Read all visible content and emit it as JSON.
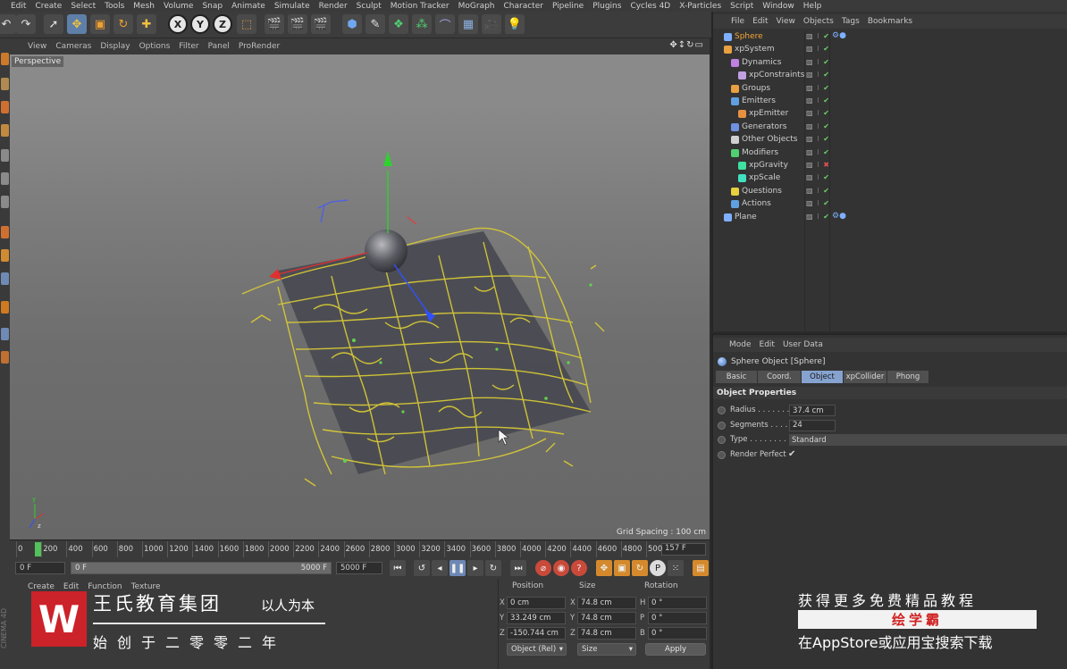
{
  "menubar": [
    "Edit",
    "Create",
    "Select",
    "Tools",
    "Mesh",
    "Volume",
    "Snap",
    "Animate",
    "Simulate",
    "Render",
    "Sculpt",
    "Motion Tracker",
    "MoGraph",
    "Character",
    "Pipeline",
    "Plugins",
    "Cycles 4D",
    "X-Particles",
    "Script",
    "Window",
    "Help"
  ],
  "viewport": {
    "menu": [
      "View",
      "Cameras",
      "Display",
      "Options",
      "Filter",
      "Panel",
      "ProRender"
    ],
    "label": "Perspective",
    "grid_spacing": "Grid Spacing : 100 cm"
  },
  "timeline": {
    "ticks": [
      "0",
      "200",
      "400",
      "600",
      "800",
      "1000",
      "1200",
      "1400",
      "1600",
      "1800",
      "2000",
      "2200",
      "2400",
      "2600",
      "2800",
      "3000",
      "3200",
      "3400",
      "3600",
      "3800",
      "4000",
      "4200",
      "4400",
      "4600",
      "4800",
      "500"
    ],
    "current_frame": "157 F"
  },
  "transport": {
    "start": "0 F",
    "range_start": "0 F",
    "range_end": "5000 F",
    "end": "5000 F"
  },
  "bottom_menu": [
    "Create",
    "Edit",
    "Function",
    "Texture"
  ],
  "cinema_tag": "CINEMA 4D",
  "coord": {
    "headers": {
      "position": "Position",
      "size": "Size",
      "rotation": "Rotation"
    },
    "rows": [
      {
        "axis": "X",
        "pos": "0 cm",
        "size_axis": "X",
        "size": "74.8 cm",
        "rot_axis": "H",
        "rot": "0 °"
      },
      {
        "axis": "Y",
        "pos": "33.249 cm",
        "size_axis": "Y",
        "size": "74.8 cm",
        "rot_axis": "P",
        "rot": "0 °"
      },
      {
        "axis": "Z",
        "pos": "-150.744 cm",
        "size_axis": "Z",
        "size": "74.8 cm",
        "rot_axis": "B",
        "rot": "0 °"
      }
    ],
    "mode": "Object (Rel)",
    "size_mode": "Size",
    "apply": "Apply"
  },
  "objects": {
    "menu": [
      "File",
      "Edit",
      "View",
      "Objects",
      "Tags",
      "Bookmarks"
    ],
    "items": [
      {
        "label": "Sphere",
        "color": "#7fb0ff",
        "selected": true,
        "flag": "ok",
        "tag": "⚙●"
      },
      {
        "label": "xpSystem",
        "color": "#e8a040",
        "selected": false,
        "flag": "ok",
        "tag": ""
      },
      {
        "label": "Dynamics",
        "color": "#c080e0",
        "selected": false,
        "flag": "ok",
        "tag": ""
      },
      {
        "label": "xpConstraints",
        "color": "#c0a0e0",
        "selected": false,
        "flag": "ok",
        "tag": ""
      },
      {
        "label": "Groups",
        "color": "#e8a040",
        "selected": false,
        "flag": "ok",
        "tag": ""
      },
      {
        "label": "Emitters",
        "color": "#60a0e0",
        "selected": false,
        "flag": "ok",
        "tag": ""
      },
      {
        "label": "xpEmitter",
        "color": "#e89040",
        "selected": false,
        "flag": "ok",
        "tag": ""
      },
      {
        "label": "Generators",
        "color": "#7090e0",
        "selected": false,
        "flag": "ok",
        "tag": ""
      },
      {
        "label": "Other Objects",
        "color": "#d0d0d0",
        "selected": false,
        "flag": "ok",
        "tag": ""
      },
      {
        "label": "Modifiers",
        "color": "#50d070",
        "selected": false,
        "flag": "ok",
        "tag": ""
      },
      {
        "label": "xpGravity",
        "color": "#40e0a0",
        "selected": false,
        "flag": "off",
        "tag": ""
      },
      {
        "label": "xpScale",
        "color": "#40e0c0",
        "selected": false,
        "flag": "ok",
        "tag": ""
      },
      {
        "label": "Questions",
        "color": "#e8d040",
        "selected": false,
        "flag": "ok",
        "tag": ""
      },
      {
        "label": "Actions",
        "color": "#60a0e0",
        "selected": false,
        "flag": "ok",
        "tag": ""
      },
      {
        "label": "Plane",
        "color": "#7fb0ff",
        "selected": false,
        "flag": "ok",
        "tag": "⚙●"
      }
    ]
  },
  "attributes": {
    "menu": [
      "Mode",
      "Edit",
      "User Data"
    ],
    "title": "Sphere Object [Sphere]",
    "tabs": [
      "Basic",
      "Coord.",
      "Object",
      "xpCollider",
      "Phong"
    ],
    "active_tab": "Object",
    "section": "Object Properties",
    "props": [
      {
        "label": "Radius . . . . . . . .",
        "value": "37.4 cm"
      },
      {
        "label": "Segments . . . . . .",
        "value": "24"
      },
      {
        "label": "Type . . . . . . . . . .",
        "value": "Standard"
      },
      {
        "label": "Render Perfect",
        "value": "✔"
      }
    ]
  },
  "watermark": {
    "logo": "W",
    "title": "王氏教育集团",
    "motto": "以人为本",
    "sub": "始创于二零零二年"
  },
  "promo": {
    "line1": "获得更多免费精品教程",
    "band": "绘学霸",
    "line2": "在AppStore或应用宝搜索下载"
  }
}
